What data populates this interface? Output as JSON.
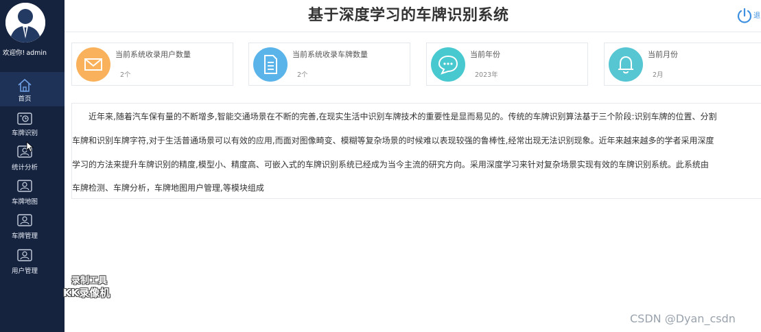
{
  "sidebar": {
    "welcome_prefix": "欢迎你!",
    "username": "admin",
    "items": [
      {
        "label": "首页",
        "icon": "home-icon"
      },
      {
        "label": "车牌识别",
        "icon": "plate-recognize-icon"
      },
      {
        "label": "统计分析",
        "icon": "user-card-icon"
      },
      {
        "label": "车牌地图",
        "icon": "user-card-icon"
      },
      {
        "label": "车牌管理",
        "icon": "user-card-icon"
      },
      {
        "label": "用户管理",
        "icon": "user-card-icon"
      }
    ]
  },
  "header": {
    "title": "基于深度学习的车牌识别系统",
    "logout_label": "退出"
  },
  "cards": [
    {
      "title": "当前系统收录用户数量",
      "value": "2个",
      "icon": "mail-icon",
      "color": "#f9b25b"
    },
    {
      "title": "当前系统收录车牌数量",
      "value": "2个",
      "icon": "document-icon",
      "color": "#5ab4ea"
    },
    {
      "title": "当前年份",
      "value": "2023年",
      "icon": "chat-icon",
      "color": "#48c8cf"
    },
    {
      "title": "当前月份",
      "value": "2月",
      "icon": "bell-icon",
      "color": "#56c6d2"
    }
  ],
  "intro": {
    "lines": [
      "近年来,随着汽车保有量的不断增多,智能交通场景在不断的完善,在现实生活中识别车牌技术的重要性是显而易见的。传统的车牌识别算法基于三个阶段:识别车牌的位置、分割",
      "车牌和识别车牌字符,对于生活普通场景可以有效的应用,而面对图像畸变、模糊等复杂场景的时候难以表现较强的鲁棒性,经常出现无法识别现象。近年来越来越多的学者采用深度",
      "学习的方法来提升车牌识别的精度,模型小、精度高、可嵌入式的车牌识别系统已经成为当今主流的研究方向。采用深度学习来针对复杂场景实现有效的车牌识别系统。此系统由",
      "车牌检测、车牌分析，车牌地图用户管理,等模块组成"
    ]
  },
  "watermarks": {
    "recorder_line1": "录制工具",
    "recorder_line2": "KK录像机",
    "csdn": "CSDN @Dyan_csdn"
  },
  "colors": {
    "sidebar_bg": "#15233f",
    "sidebar_active": "#1d3256",
    "accent": "#3d8fe0"
  }
}
